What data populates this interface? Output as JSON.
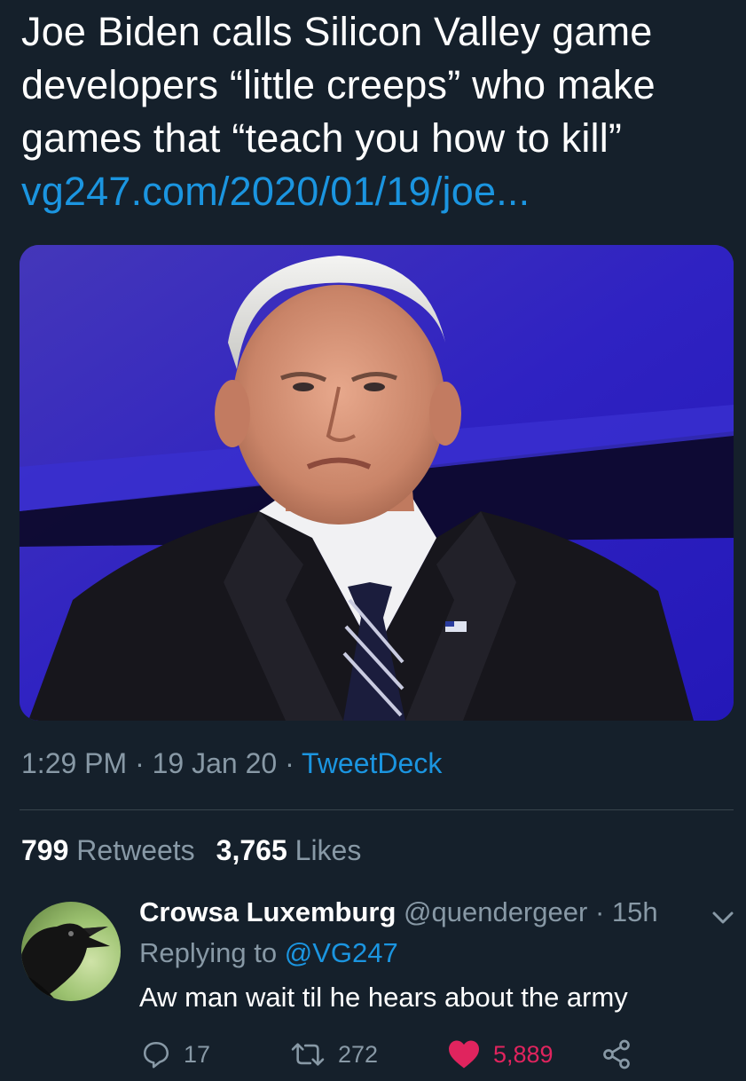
{
  "tweet": {
    "text_lines": [
      "Joe Biden calls Silicon Valley game",
      "developers “little creeps” who make",
      "games that “teach you how to kill”"
    ],
    "link": "vg247.com/2020/01/19/joe...",
    "time": "1:29 PM",
    "date": "19 Jan 20",
    "source": "TweetDeck",
    "separator": "·",
    "retweets_count": "799",
    "retweets_label": "Retweets",
    "likes_count": "3,765",
    "likes_label": "Likes"
  },
  "reply": {
    "name": "Crowsa Luxemburg",
    "handle": "@quendergeer",
    "time": "15h",
    "separator": "·",
    "replying_label": "Replying to",
    "replying_to": "@VG247",
    "text": "Aw man wait til he hears about the army",
    "replies": "17",
    "retweets": "272",
    "likes": "5,889"
  },
  "icons": {
    "reply": "reply-icon",
    "retweet": "retweet-icon",
    "like": "heart-icon",
    "share": "share-icon",
    "caret": "chevron-down-icon"
  },
  "colors": {
    "background": "#15202b",
    "link": "#1b95e0",
    "muted": "#8899a6",
    "like": "#e0245e",
    "divider": "#38444d"
  }
}
